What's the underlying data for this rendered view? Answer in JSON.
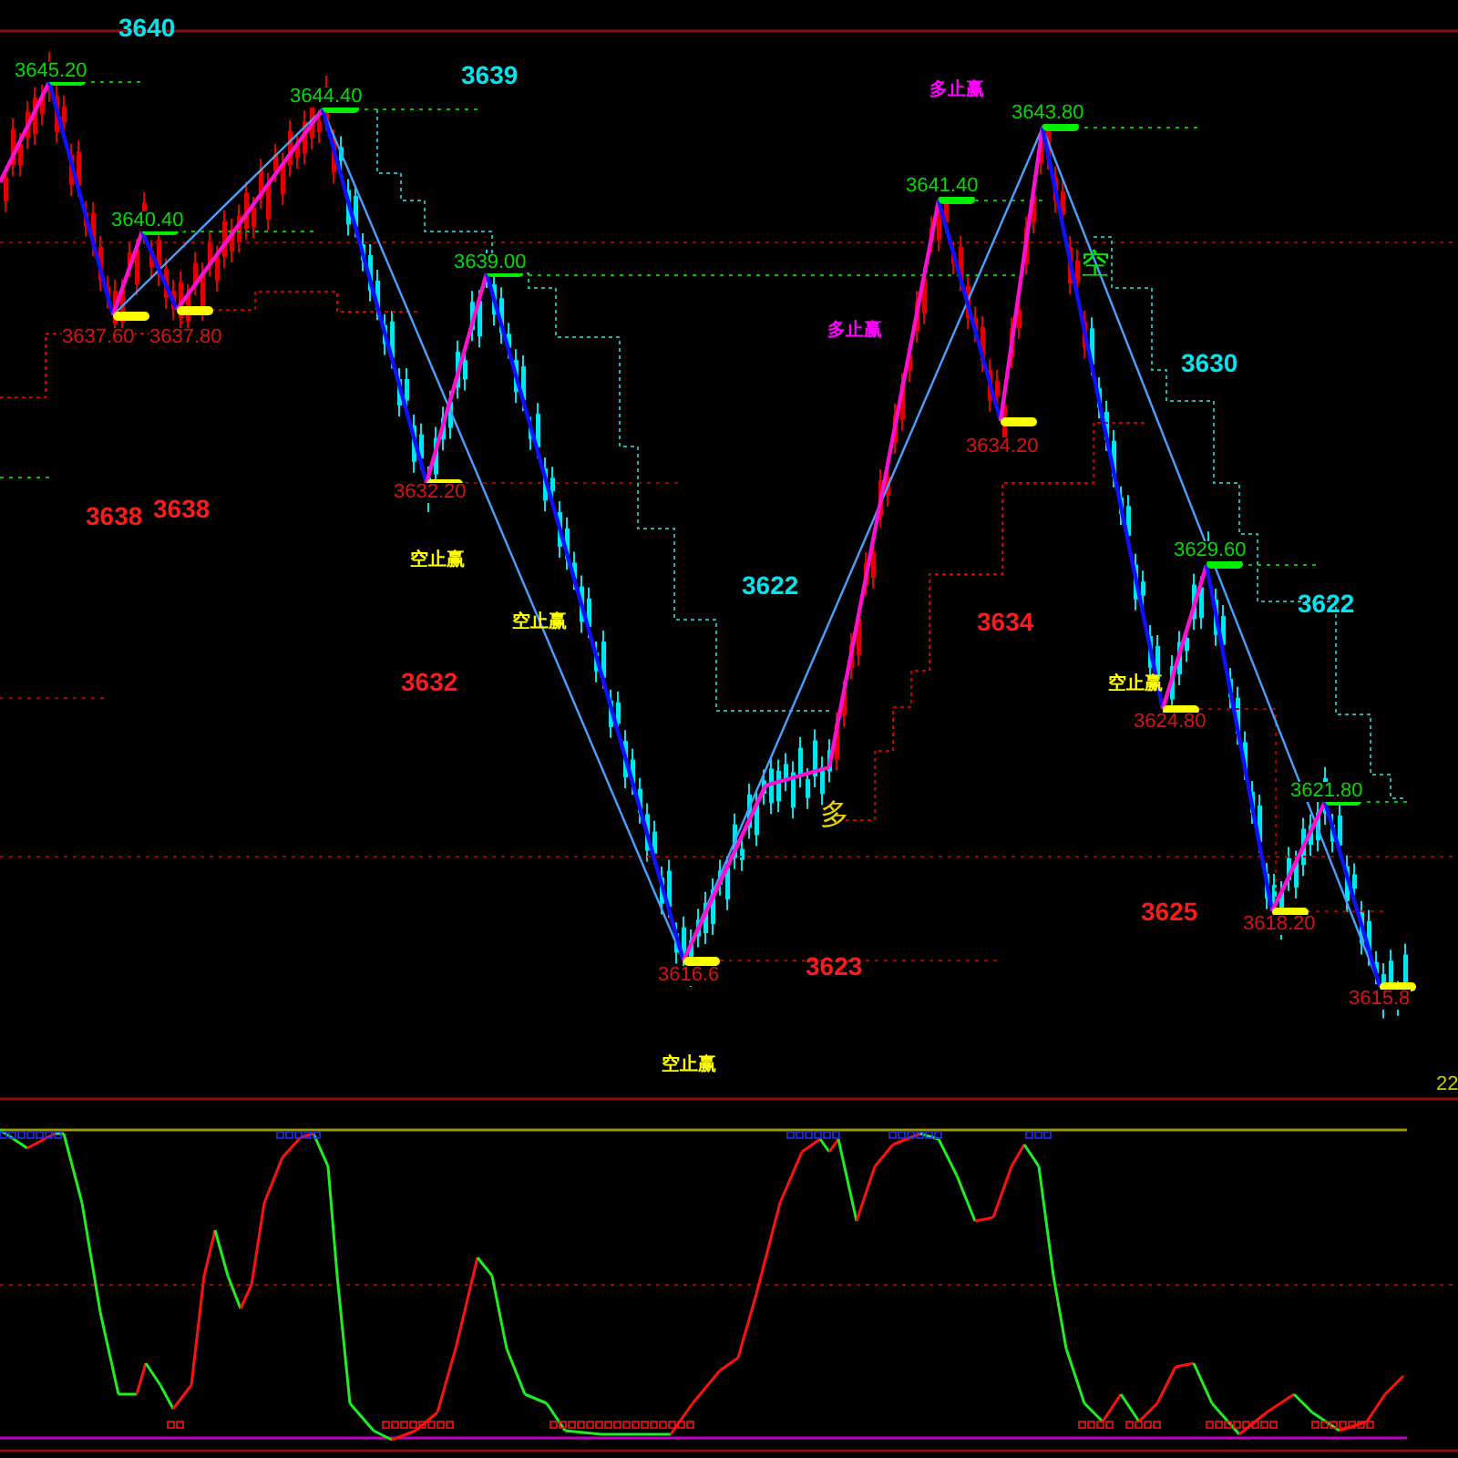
{
  "labels": [
    {
      "kind": "level",
      "text": "3640",
      "color": "#00e5ee"
    },
    {
      "kind": "high",
      "text": "3645.20"
    },
    {
      "kind": "level",
      "text": "3639",
      "color": "#00e5ee"
    },
    {
      "kind": "high",
      "text": "3644.40"
    },
    {
      "kind": "tag",
      "text": "多止赢",
      "color": "#ff00ff"
    },
    {
      "kind": "high",
      "text": "3643.80"
    },
    {
      "kind": "high",
      "text": "3641.40"
    },
    {
      "kind": "high",
      "text": "3640.40"
    },
    {
      "kind": "high",
      "text": "3639.00"
    },
    {
      "kind": "glyph",
      "text": "空",
      "color": "#00ee00"
    },
    {
      "kind": "low",
      "text": "3637.60"
    },
    {
      "kind": "low",
      "text": "3637.80"
    },
    {
      "kind": "tag",
      "text": "多止赢",
      "color": "#ff00ff"
    },
    {
      "kind": "level",
      "text": "3630",
      "color": "#00e5ee"
    },
    {
      "kind": "low",
      "text": "3634.20"
    },
    {
      "kind": "level",
      "text": "3638",
      "color": "#ff1a1a"
    },
    {
      "kind": "level",
      "text": "3638",
      "color": "#ff1a1a"
    },
    {
      "kind": "low",
      "text": "3632.20"
    },
    {
      "kind": "tag",
      "text": "空止赢",
      "color": "#ffff00"
    },
    {
      "kind": "high",
      "text": "3629.60"
    },
    {
      "kind": "level",
      "text": "3622",
      "color": "#00e5ee"
    },
    {
      "kind": "level",
      "text": "3622",
      "color": "#00e5ee"
    },
    {
      "kind": "tag",
      "text": "空止赢",
      "color": "#ffff00"
    },
    {
      "kind": "level",
      "text": "3634",
      "color": "#ff1a1a"
    },
    {
      "kind": "level",
      "text": "3632",
      "color": "#ff1a1a"
    },
    {
      "kind": "tag",
      "text": "空止赢",
      "color": "#ffff00"
    },
    {
      "kind": "low",
      "text": "3624.80"
    },
    {
      "kind": "high",
      "text": "3621.80"
    },
    {
      "kind": "glyph",
      "text": "多",
      "color": "#e6d200"
    },
    {
      "kind": "level",
      "text": "3625",
      "color": "#ff1a1a"
    },
    {
      "kind": "low",
      "text": "3618.20"
    },
    {
      "kind": "low",
      "text": "3616.6"
    },
    {
      "kind": "level",
      "text": "3623",
      "color": "#ff1a1a"
    },
    {
      "kind": "low",
      "text": "3615.8"
    },
    {
      "kind": "tag",
      "text": "空止赢",
      "color": "#ffff00"
    },
    {
      "kind": "axis",
      "text": "22"
    }
  ]
}
